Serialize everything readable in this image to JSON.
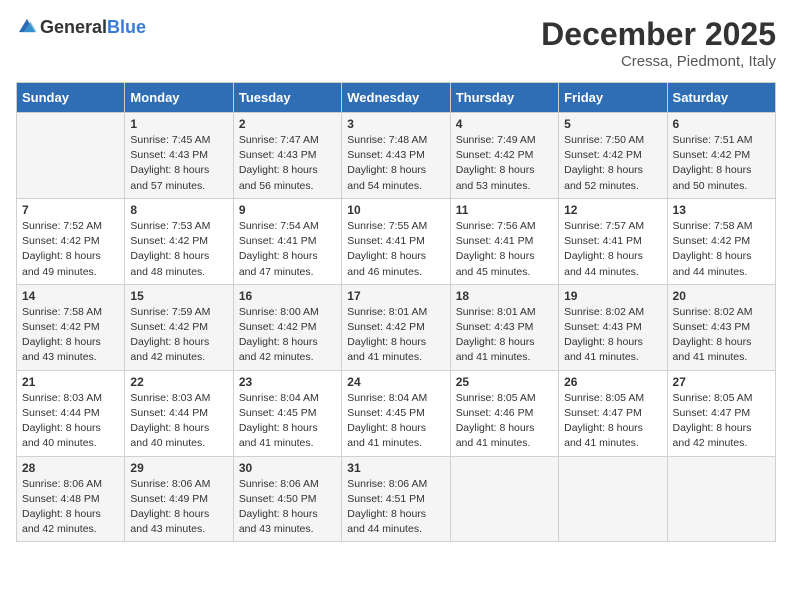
{
  "header": {
    "logo_general": "General",
    "logo_blue": "Blue",
    "month": "December 2025",
    "location": "Cressa, Piedmont, Italy"
  },
  "days_of_week": [
    "Sunday",
    "Monday",
    "Tuesday",
    "Wednesday",
    "Thursday",
    "Friday",
    "Saturday"
  ],
  "weeks": [
    [
      {
        "day": "",
        "sunrise": "",
        "sunset": "",
        "daylight": ""
      },
      {
        "day": "1",
        "sunrise": "Sunrise: 7:45 AM",
        "sunset": "Sunset: 4:43 PM",
        "daylight": "Daylight: 8 hours and 57 minutes."
      },
      {
        "day": "2",
        "sunrise": "Sunrise: 7:47 AM",
        "sunset": "Sunset: 4:43 PM",
        "daylight": "Daylight: 8 hours and 56 minutes."
      },
      {
        "day": "3",
        "sunrise": "Sunrise: 7:48 AM",
        "sunset": "Sunset: 4:43 PM",
        "daylight": "Daylight: 8 hours and 54 minutes."
      },
      {
        "day": "4",
        "sunrise": "Sunrise: 7:49 AM",
        "sunset": "Sunset: 4:42 PM",
        "daylight": "Daylight: 8 hours and 53 minutes."
      },
      {
        "day": "5",
        "sunrise": "Sunrise: 7:50 AM",
        "sunset": "Sunset: 4:42 PM",
        "daylight": "Daylight: 8 hours and 52 minutes."
      },
      {
        "day": "6",
        "sunrise": "Sunrise: 7:51 AM",
        "sunset": "Sunset: 4:42 PM",
        "daylight": "Daylight: 8 hours and 50 minutes."
      }
    ],
    [
      {
        "day": "7",
        "sunrise": "Sunrise: 7:52 AM",
        "sunset": "Sunset: 4:42 PM",
        "daylight": "Daylight: 8 hours and 49 minutes."
      },
      {
        "day": "8",
        "sunrise": "Sunrise: 7:53 AM",
        "sunset": "Sunset: 4:42 PM",
        "daylight": "Daylight: 8 hours and 48 minutes."
      },
      {
        "day": "9",
        "sunrise": "Sunrise: 7:54 AM",
        "sunset": "Sunset: 4:41 PM",
        "daylight": "Daylight: 8 hours and 47 minutes."
      },
      {
        "day": "10",
        "sunrise": "Sunrise: 7:55 AM",
        "sunset": "Sunset: 4:41 PM",
        "daylight": "Daylight: 8 hours and 46 minutes."
      },
      {
        "day": "11",
        "sunrise": "Sunrise: 7:56 AM",
        "sunset": "Sunset: 4:41 PM",
        "daylight": "Daylight: 8 hours and 45 minutes."
      },
      {
        "day": "12",
        "sunrise": "Sunrise: 7:57 AM",
        "sunset": "Sunset: 4:41 PM",
        "daylight": "Daylight: 8 hours and 44 minutes."
      },
      {
        "day": "13",
        "sunrise": "Sunrise: 7:58 AM",
        "sunset": "Sunset: 4:42 PM",
        "daylight": "Daylight: 8 hours and 44 minutes."
      }
    ],
    [
      {
        "day": "14",
        "sunrise": "Sunrise: 7:58 AM",
        "sunset": "Sunset: 4:42 PM",
        "daylight": "Daylight: 8 hours and 43 minutes."
      },
      {
        "day": "15",
        "sunrise": "Sunrise: 7:59 AM",
        "sunset": "Sunset: 4:42 PM",
        "daylight": "Daylight: 8 hours and 42 minutes."
      },
      {
        "day": "16",
        "sunrise": "Sunrise: 8:00 AM",
        "sunset": "Sunset: 4:42 PM",
        "daylight": "Daylight: 8 hours and 42 minutes."
      },
      {
        "day": "17",
        "sunrise": "Sunrise: 8:01 AM",
        "sunset": "Sunset: 4:42 PM",
        "daylight": "Daylight: 8 hours and 41 minutes."
      },
      {
        "day": "18",
        "sunrise": "Sunrise: 8:01 AM",
        "sunset": "Sunset: 4:43 PM",
        "daylight": "Daylight: 8 hours and 41 minutes."
      },
      {
        "day": "19",
        "sunrise": "Sunrise: 8:02 AM",
        "sunset": "Sunset: 4:43 PM",
        "daylight": "Daylight: 8 hours and 41 minutes."
      },
      {
        "day": "20",
        "sunrise": "Sunrise: 8:02 AM",
        "sunset": "Sunset: 4:43 PM",
        "daylight": "Daylight: 8 hours and 41 minutes."
      }
    ],
    [
      {
        "day": "21",
        "sunrise": "Sunrise: 8:03 AM",
        "sunset": "Sunset: 4:44 PM",
        "daylight": "Daylight: 8 hours and 40 minutes."
      },
      {
        "day": "22",
        "sunrise": "Sunrise: 8:03 AM",
        "sunset": "Sunset: 4:44 PM",
        "daylight": "Daylight: 8 hours and 40 minutes."
      },
      {
        "day": "23",
        "sunrise": "Sunrise: 8:04 AM",
        "sunset": "Sunset: 4:45 PM",
        "daylight": "Daylight: 8 hours and 41 minutes."
      },
      {
        "day": "24",
        "sunrise": "Sunrise: 8:04 AM",
        "sunset": "Sunset: 4:45 PM",
        "daylight": "Daylight: 8 hours and 41 minutes."
      },
      {
        "day": "25",
        "sunrise": "Sunrise: 8:05 AM",
        "sunset": "Sunset: 4:46 PM",
        "daylight": "Daylight: 8 hours and 41 minutes."
      },
      {
        "day": "26",
        "sunrise": "Sunrise: 8:05 AM",
        "sunset": "Sunset: 4:47 PM",
        "daylight": "Daylight: 8 hours and 41 minutes."
      },
      {
        "day": "27",
        "sunrise": "Sunrise: 8:05 AM",
        "sunset": "Sunset: 4:47 PM",
        "daylight": "Daylight: 8 hours and 42 minutes."
      }
    ],
    [
      {
        "day": "28",
        "sunrise": "Sunrise: 8:06 AM",
        "sunset": "Sunset: 4:48 PM",
        "daylight": "Daylight: 8 hours and 42 minutes."
      },
      {
        "day": "29",
        "sunrise": "Sunrise: 8:06 AM",
        "sunset": "Sunset: 4:49 PM",
        "daylight": "Daylight: 8 hours and 43 minutes."
      },
      {
        "day": "30",
        "sunrise": "Sunrise: 8:06 AM",
        "sunset": "Sunset: 4:50 PM",
        "daylight": "Daylight: 8 hours and 43 minutes."
      },
      {
        "day": "31",
        "sunrise": "Sunrise: 8:06 AM",
        "sunset": "Sunset: 4:51 PM",
        "daylight": "Daylight: 8 hours and 44 minutes."
      },
      {
        "day": "",
        "sunrise": "",
        "sunset": "",
        "daylight": ""
      },
      {
        "day": "",
        "sunrise": "",
        "sunset": "",
        "daylight": ""
      },
      {
        "day": "",
        "sunrise": "",
        "sunset": "",
        "daylight": ""
      }
    ]
  ]
}
